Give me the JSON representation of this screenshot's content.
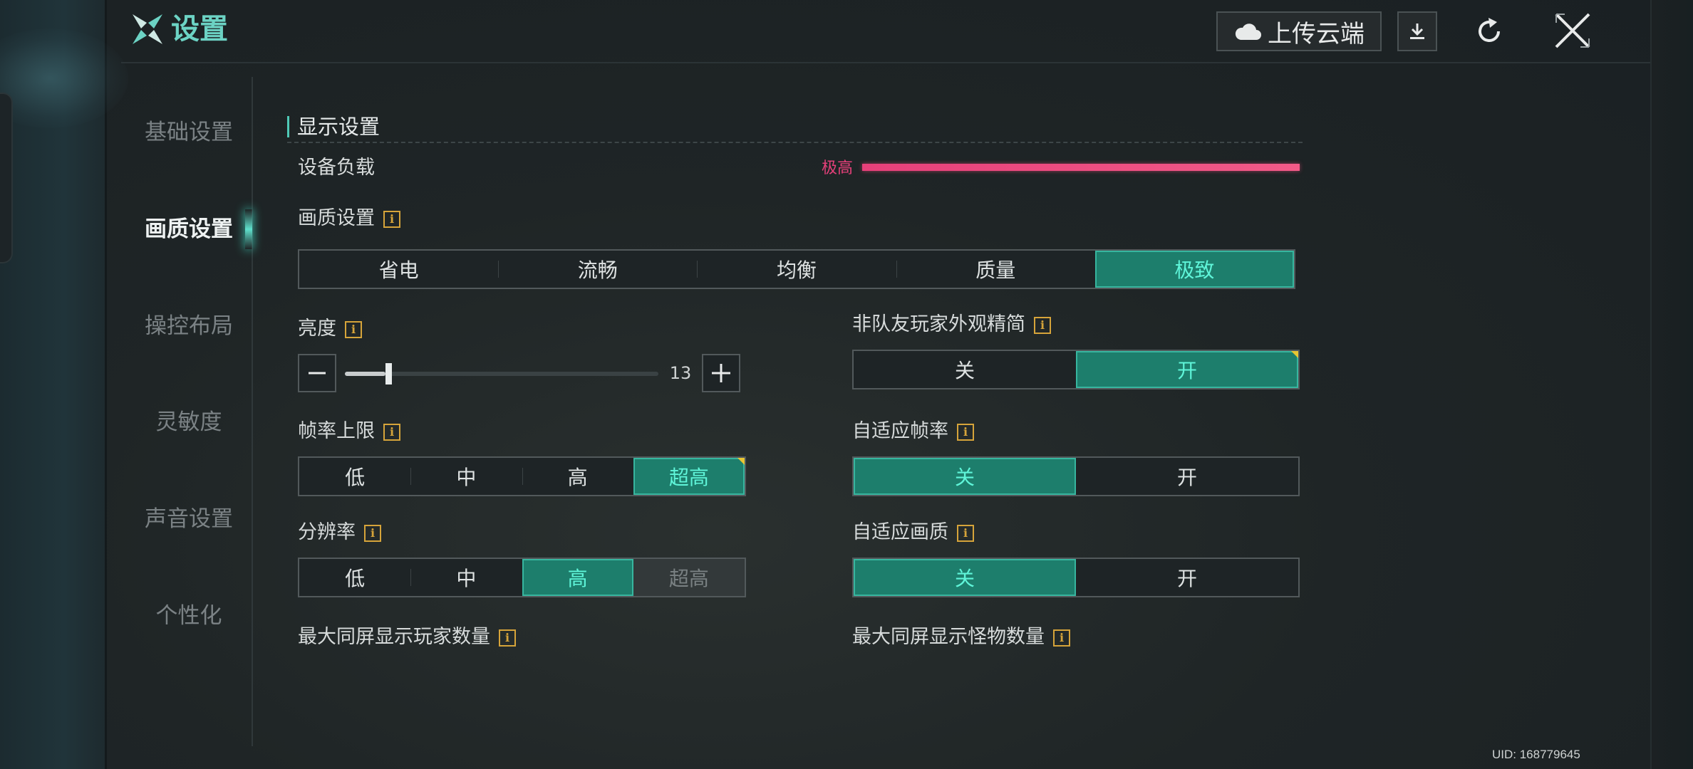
{
  "header": {
    "title": "设置",
    "upload_label": "上传云端"
  },
  "sidebar": {
    "items": [
      {
        "label": "基础设置",
        "active": false
      },
      {
        "label": "画质设置",
        "active": true
      },
      {
        "label": "操控布局",
        "active": false
      },
      {
        "label": "灵敏度",
        "active": false
      },
      {
        "label": "声音设置",
        "active": false
      },
      {
        "label": "个性化",
        "active": false
      }
    ]
  },
  "section": {
    "title": "显示设置"
  },
  "device_load": {
    "label": "设备负载",
    "level_text": "极高",
    "level_fraction": 1.0,
    "color": "#e8417b"
  },
  "quality_preset": {
    "label": "画质设置",
    "options": [
      "省电",
      "流畅",
      "均衡",
      "质量",
      "极致"
    ],
    "selected": "极致"
  },
  "brightness": {
    "label": "亮度",
    "value": "13",
    "fraction": 0.13
  },
  "simplify_players": {
    "label": "非队友玩家外观精简",
    "options": [
      "关",
      "开"
    ],
    "selected": "开"
  },
  "frame_rate": {
    "label": "帧率上限",
    "options": [
      "低",
      "中",
      "高",
      "超高"
    ],
    "selected": "超高"
  },
  "adaptive_fps": {
    "label": "自适应帧率",
    "options": [
      "关",
      "开"
    ],
    "selected": "关"
  },
  "resolution": {
    "label": "分辨率",
    "options": [
      "低",
      "中",
      "高",
      "超高"
    ],
    "selected": "高",
    "disabled": "超高"
  },
  "adaptive_quality": {
    "label": "自适应画质",
    "options": [
      "关",
      "开"
    ],
    "selected": "关"
  },
  "max_players": {
    "label": "最大同屏显示玩家数量"
  },
  "max_monsters": {
    "label": "最大同屏显示怪物数量"
  },
  "info_glyph": "i",
  "uid": "UID: 168779645",
  "colors": {
    "accent": "#6cd3c4",
    "selected_bg": "#1d7e6c",
    "selected_text": "#5ff5d9",
    "info": "#d6a43a",
    "corner_marker": "#e8c533"
  }
}
